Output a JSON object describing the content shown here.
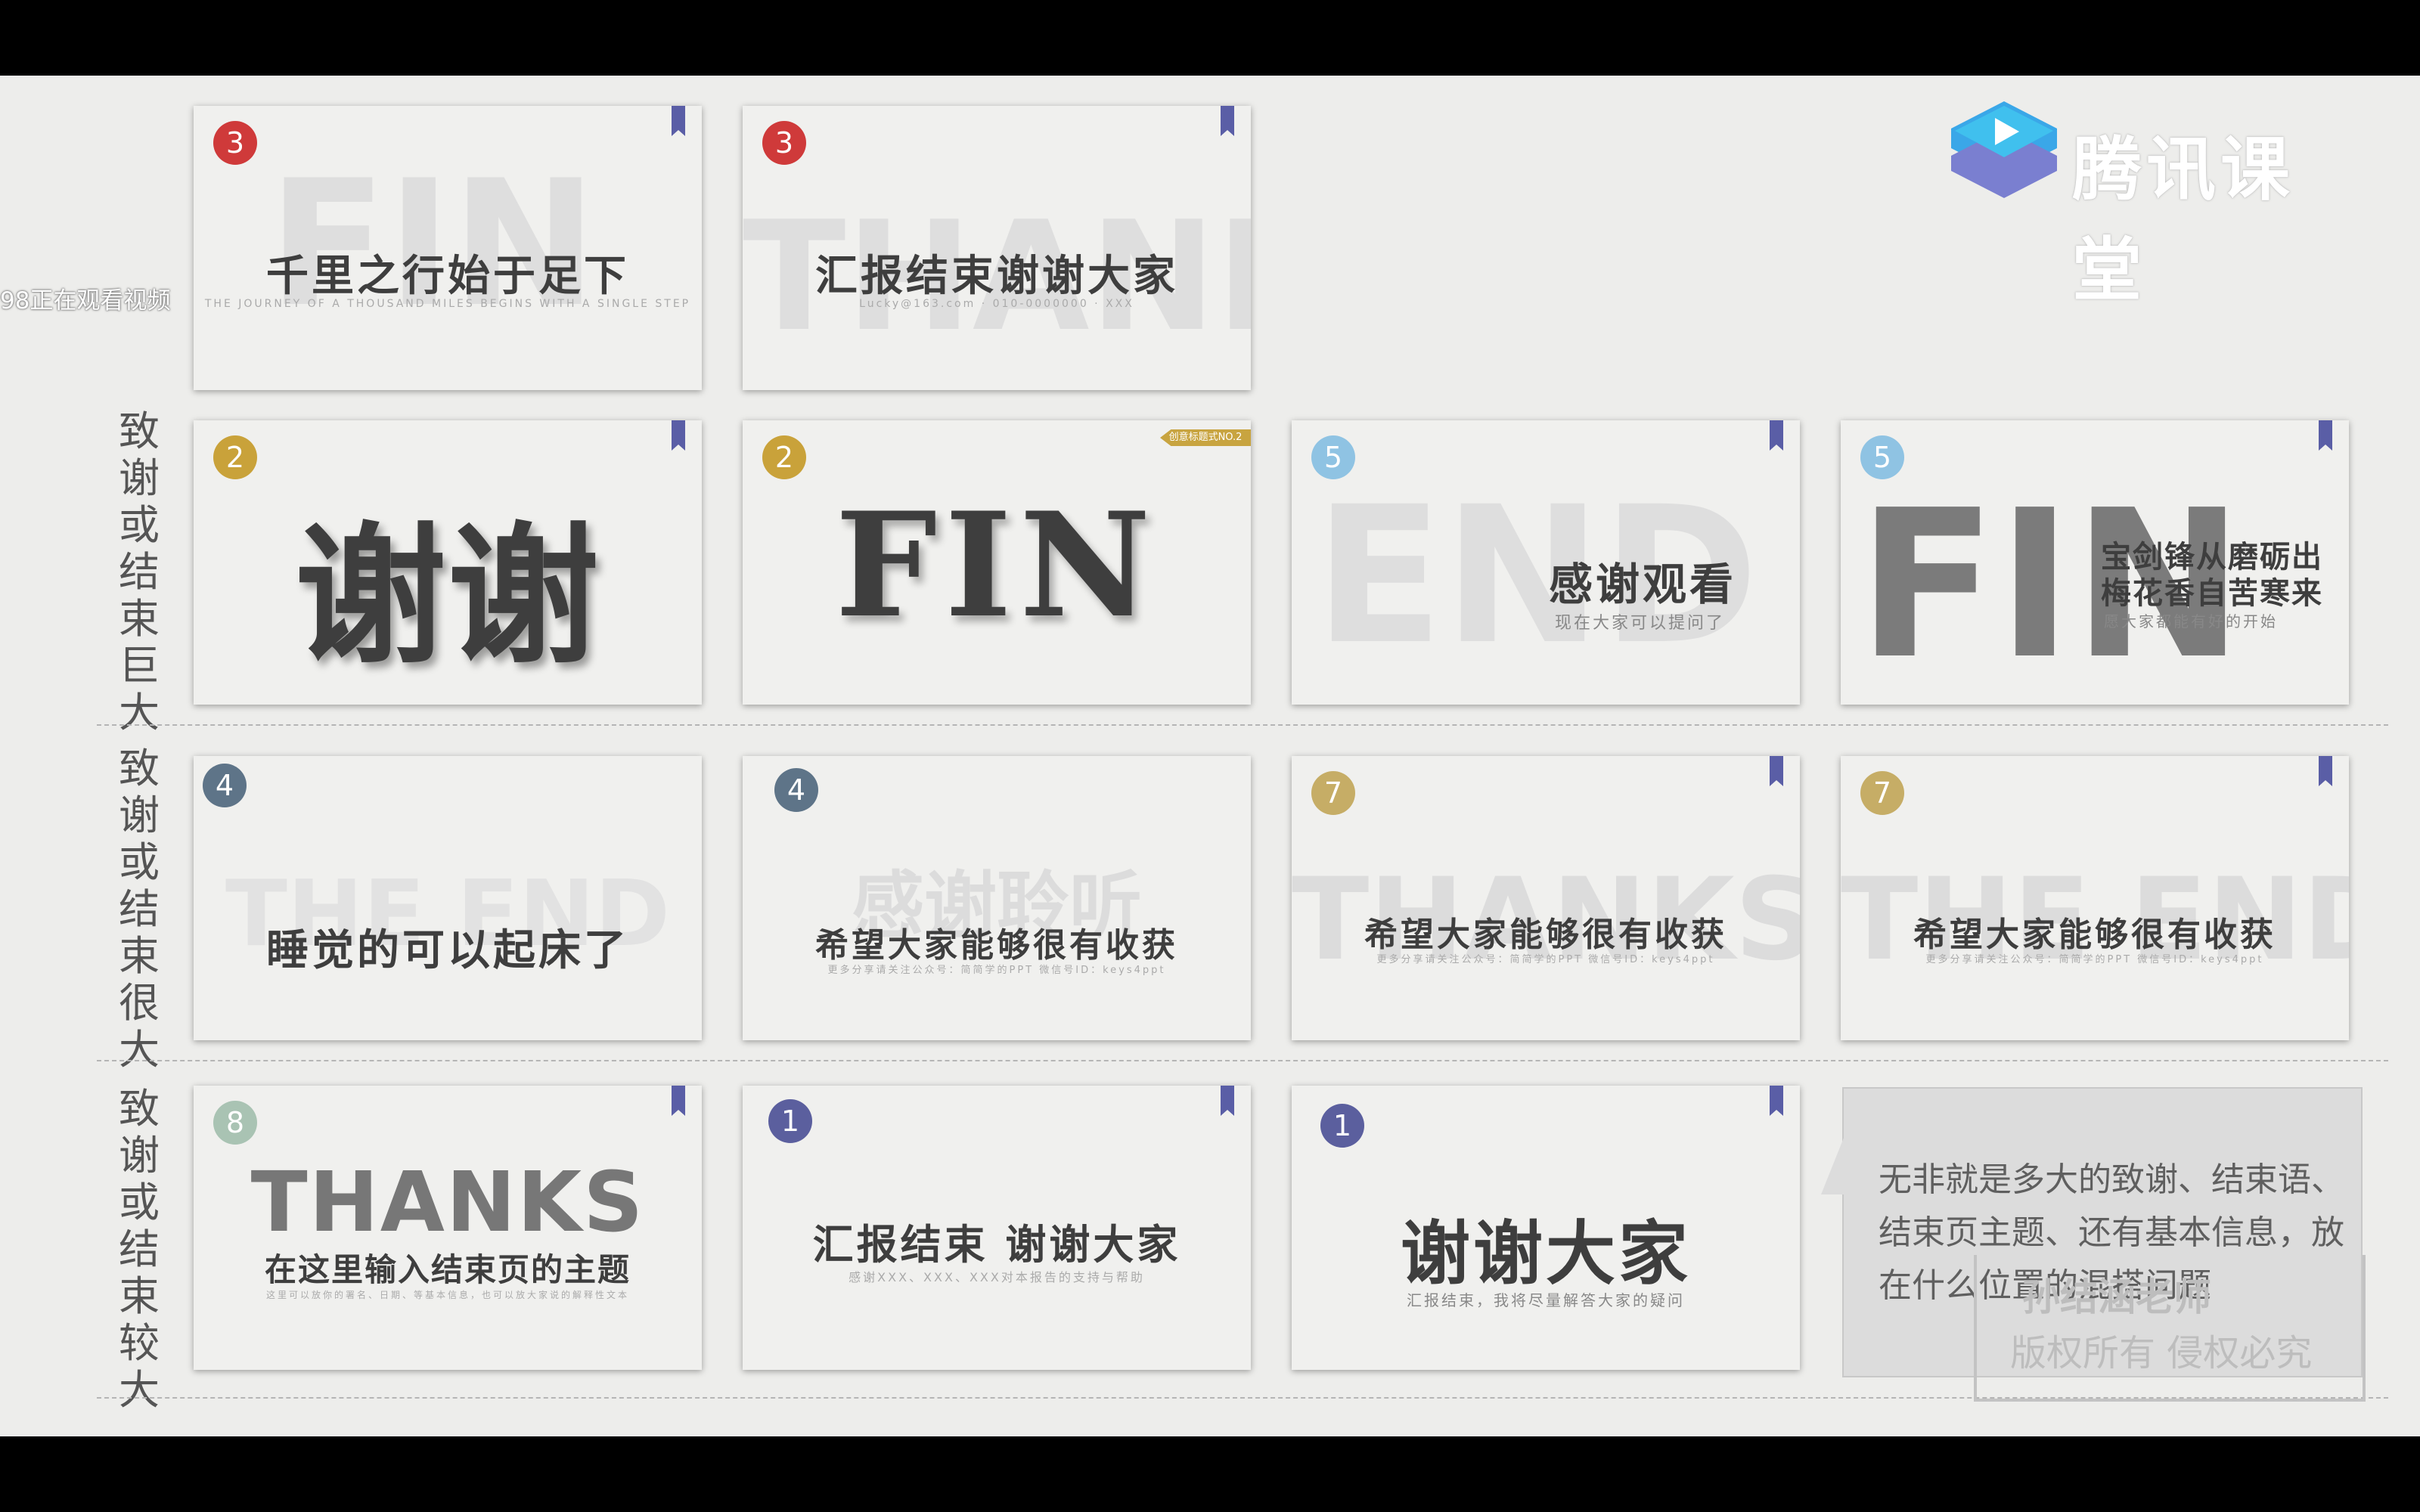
{
  "brand": {
    "name": "腾讯课堂"
  },
  "overlay": {
    "watching": "98正在观看视频"
  },
  "rows": [
    {
      "label": "致谢或结束巨大"
    },
    {
      "label": "致谢或结束很大"
    },
    {
      "label": "致谢或结束较大"
    }
  ],
  "cards": [
    {
      "badge": "3",
      "bg": "FIN",
      "title": "千里之行始于足下",
      "sub": "THE JOURNEY OF A THOUSAND MILES BEGINS WITH A SINGLE STEP"
    },
    {
      "badge": "3",
      "bg": "THANKS",
      "title": "汇报结束谢谢大家",
      "sub": "Lucky@163.com · 010-0000000 · XXX"
    },
    {
      "badge": "2",
      "title": "谢谢"
    },
    {
      "badge": "2",
      "title": "FIN",
      "tag": "创意标题式NO.2"
    },
    {
      "badge": "5",
      "bg": "END",
      "title": "感谢观看",
      "sub": "现在大家可以提问了"
    },
    {
      "badge": "5",
      "bg": "FIN",
      "title1": "宝剑锋从磨砺出",
      "title2": "梅花香自苦寒来",
      "sub": "愿大家都能有好的开始"
    },
    {
      "badge": "4",
      "bg": "THE END",
      "title": "睡觉的可以起床了"
    },
    {
      "badge": "4",
      "bg": "感谢聆听",
      "title": "希望大家能够很有收获",
      "sub": "更多分享请关注公众号：简简学的PPT 微信号ID：keys4ppt"
    },
    {
      "badge": "7",
      "bg": "THANKS",
      "title": "希望大家能够很有收获",
      "sub": "更多分享请关注公众号：简简学的PPT 微信号ID：keys4ppt"
    },
    {
      "badge": "7",
      "bg": "THE END",
      "title": "希望大家能够很有收获",
      "sub": "更多分享请关注公众号：简简学的PPT 微信号ID：keys4ppt"
    },
    {
      "badge": "8",
      "bg": "THANKS",
      "title": "在这里输入结束页的主题",
      "sub": "这里可以放你的署名、日期、等基本信息，也可以放大家说的解释性文本"
    },
    {
      "badge": "1",
      "title": "汇报结束 谢谢大家",
      "sub": "感谢XXX、XXX、XXX对本报告的支持与帮助"
    },
    {
      "badge": "1",
      "title": "谢谢大家",
      "sub": "汇报结束，我将尽量解答大家的疑问"
    }
  ],
  "note": {
    "text": "无非就是多大的致谢、结束语、结束页主题、还有基本信息，放在什么位置的混搭问题"
  },
  "watermark": {
    "line1": "孙结涵老师",
    "line2": "版权所有 侵权必究"
  },
  "colors": {
    "red": "#cf3a3a",
    "gold": "#c9a23a",
    "lightblue": "#8fc3e3",
    "slate": "#5e7488",
    "tan": "#c6ad66",
    "sage": "#a9c3b3",
    "indigo": "#5b5f9e"
  }
}
